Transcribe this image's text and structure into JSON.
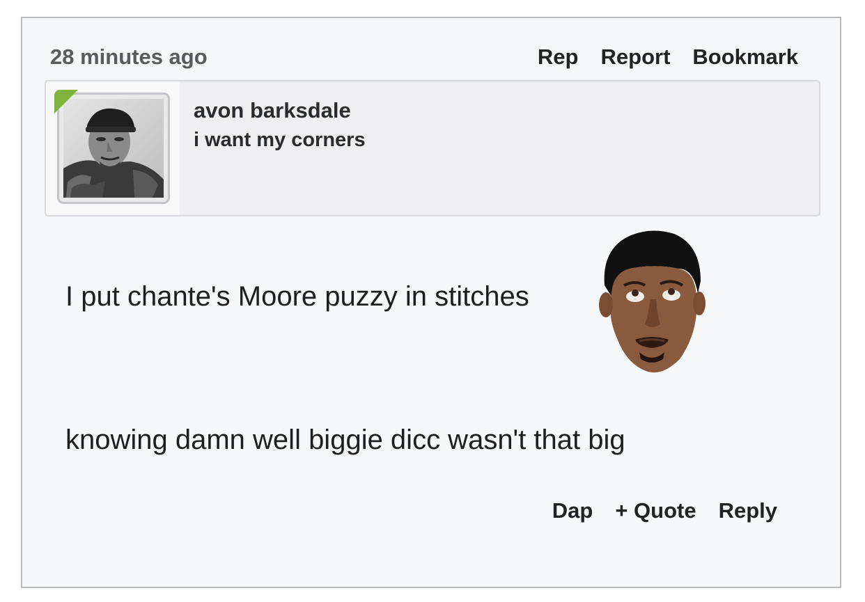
{
  "post": {
    "timestamp": "28 minutes ago",
    "header_actions": {
      "rep": "Rep",
      "report": "Report",
      "bookmark": "Bookmark"
    },
    "author": {
      "username": "avon barksdale",
      "title": "i want my corners",
      "online_indicator_color": "#7fb33c"
    },
    "body": {
      "line1": "I put chante's Moore puzzy in stitches",
      "emoji": "stephen-a-smith-eye-roll-emoji",
      "line2": "knowing damn well biggie dicc wasn't that big"
    },
    "footer_actions": {
      "dap": "Dap",
      "quote": "+ Quote",
      "reply": "Reply"
    }
  }
}
